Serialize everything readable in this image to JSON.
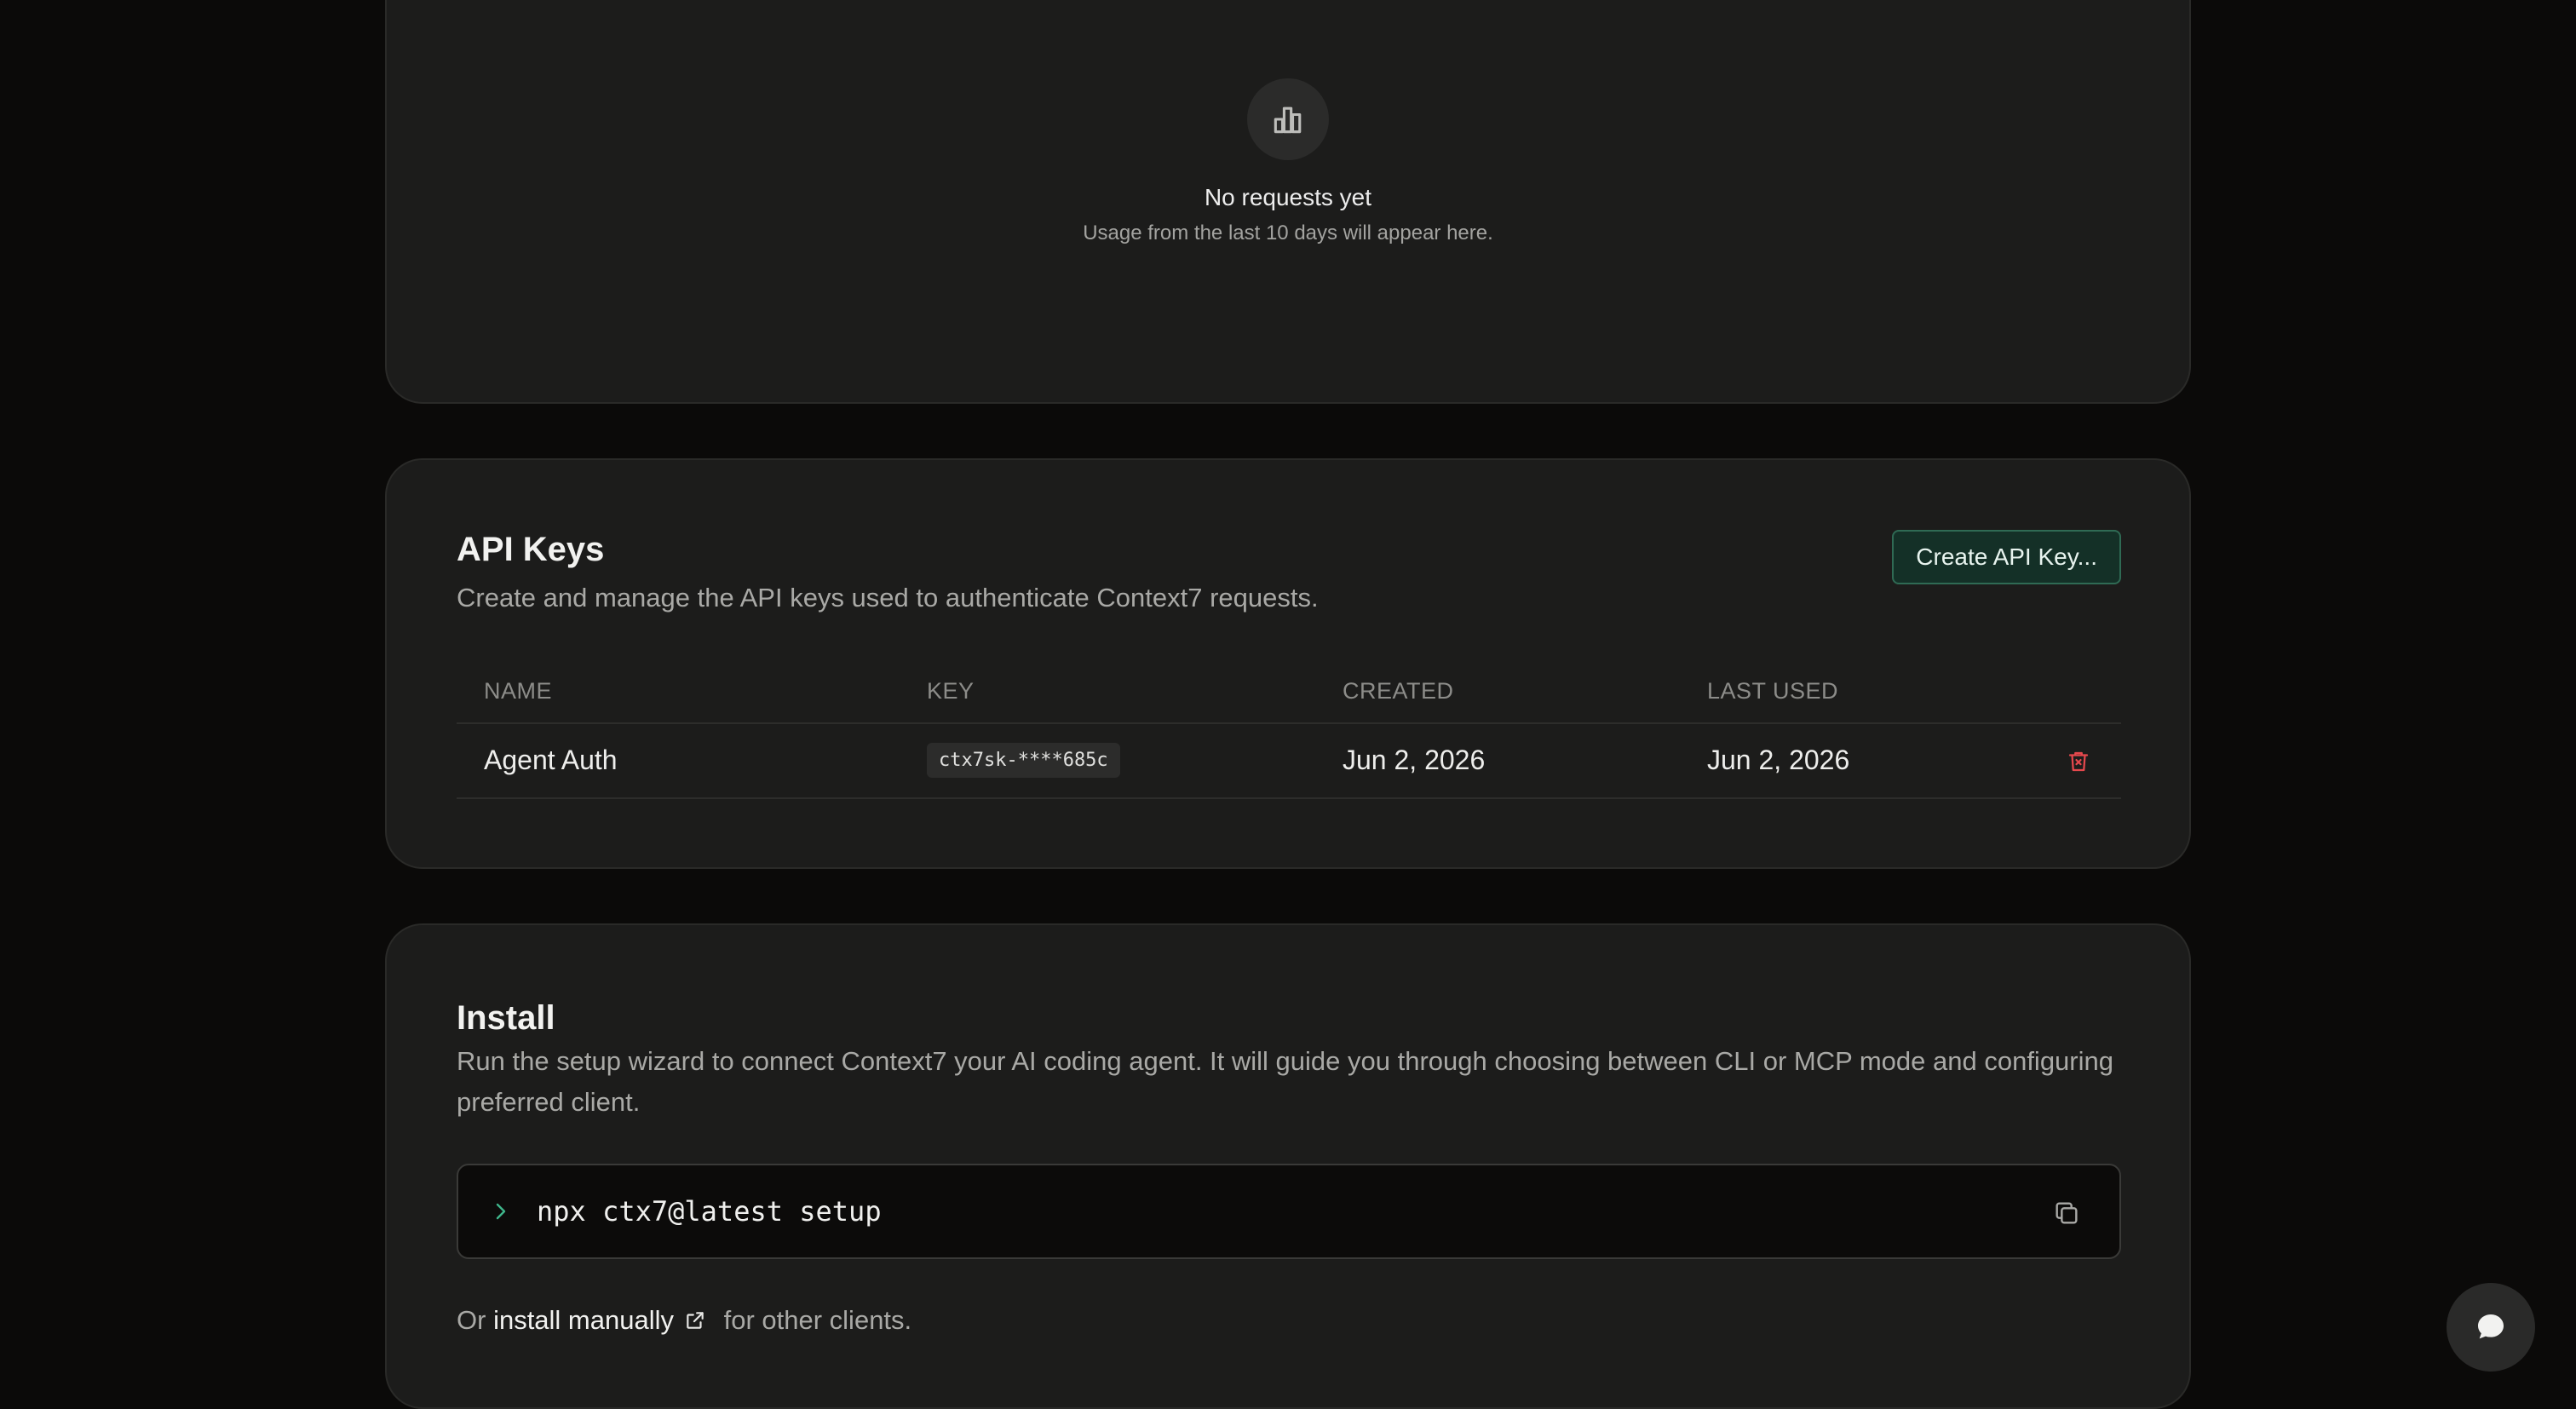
{
  "usage": {
    "empty_icon": "bar-chart-icon",
    "empty_title": "No requests yet",
    "empty_subtitle": "Usage from the last 10 days will appear here."
  },
  "api_keys": {
    "title": "API Keys",
    "description": "Create and manage the API keys used to authenticate Context7 requests.",
    "create_button": "Create API Key...",
    "columns": {
      "name": "NAME",
      "key": "KEY",
      "created": "CREATED",
      "last_used": "LAST USED"
    },
    "rows": [
      {
        "name": "Agent Auth",
        "key": "ctx7sk-****685c",
        "created": "Jun 2, 2026",
        "last_used": "Jun 2, 2026",
        "delete_icon": "trash-icon"
      }
    ]
  },
  "install": {
    "title": "Install",
    "description": "Run the setup wizard to connect Context7 your AI coding agent. It will guide you through choosing between CLI or MCP mode and configuring preferred client.",
    "command": "npx ctx7@latest setup",
    "prompt_icon": "chevron-right-icon",
    "copy_icon": "copy-icon",
    "footer_prefix": "Or ",
    "footer_link": "install manually",
    "footer_suffix": " for other clients.",
    "link_icon": "external-link-icon"
  },
  "chat": {
    "icon": "chat-bubble-icon"
  },
  "colors": {
    "background": "#0b0a09",
    "card": "#1c1c1b",
    "accent_green": "#2f6a54",
    "danger": "#e5484d",
    "prompt": "#3fb68b"
  }
}
